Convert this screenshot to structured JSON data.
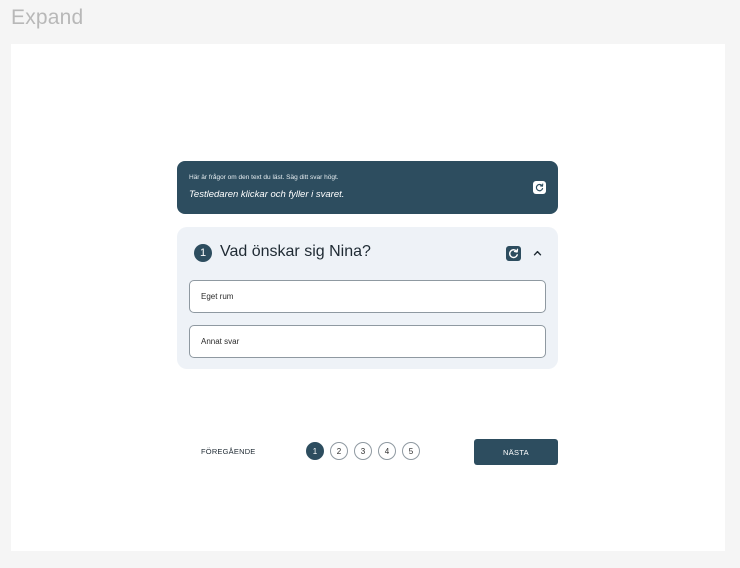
{
  "page_label": "Expand",
  "banner": {
    "instruction": "Här är frågor om den text du läst. Säg ditt svar högt.",
    "note": "Testledaren klickar och fyller i svaret.",
    "refresh_icon": "refresh-icon"
  },
  "question": {
    "number": "1",
    "title": "Vad önskar sig Nina?",
    "refresh_icon": "refresh-icon",
    "collapse_icon": "chevron-up-icon",
    "answers": [
      {
        "label": "Eget rum"
      },
      {
        "label": "Annat svar"
      }
    ]
  },
  "navigation": {
    "prev_label": "FÖREGÅENDE",
    "pages": [
      "1",
      "2",
      "3",
      "4",
      "5"
    ],
    "current_page": "1",
    "next_label": "NÄSTA"
  },
  "colors": {
    "primary": "#2d4d5f",
    "card_bg": "#eef2f7",
    "frame_bg": "#ffffff",
    "page_bg": "#f5f5f5"
  }
}
